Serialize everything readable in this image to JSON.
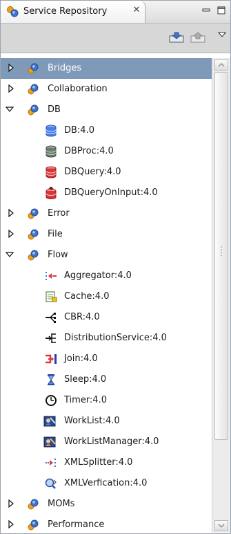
{
  "view": {
    "title": "Service Repository",
    "close_glyph": "✕"
  },
  "icons": {
    "view_icon": "service-repository-icon",
    "close": "close-icon",
    "minimize": "minimize-icon",
    "maximize": "maximize-icon",
    "import": "import-icon",
    "export": "export-icon",
    "view_menu": "view-menu-icon"
  },
  "tree": {
    "items": [
      {
        "label": "Bridges",
        "kind": "folder",
        "expanded": false,
        "selected": true
      },
      {
        "label": "Collaboration",
        "kind": "folder",
        "expanded": false
      },
      {
        "label": "DB",
        "kind": "folder",
        "expanded": true
      },
      {
        "label": "DB:4.0",
        "kind": "db",
        "color": "#4a7ee8"
      },
      {
        "label": "DBProc:4.0",
        "kind": "db",
        "color": "#6c7c6c"
      },
      {
        "label": "DBQuery:4.0",
        "kind": "db",
        "color": "#d9363a"
      },
      {
        "label": "DBQueryOnInput:4.0",
        "kind": "db-arrow",
        "color": "#d9363a"
      },
      {
        "label": "Error",
        "kind": "folder",
        "expanded": false
      },
      {
        "label": "File",
        "kind": "folder",
        "expanded": false
      },
      {
        "label": "Flow",
        "kind": "folder",
        "expanded": true
      },
      {
        "label": "Aggregator:4.0",
        "kind": "aggregator-icon"
      },
      {
        "label": "Cache:4.0",
        "kind": "cache-icon"
      },
      {
        "label": "CBR:4.0",
        "kind": "cbr-icon"
      },
      {
        "label": "DistributionService:4.0",
        "kind": "distribution-icon"
      },
      {
        "label": "Join:4.0",
        "kind": "join-icon"
      },
      {
        "label": "Sleep:4.0",
        "kind": "hourglass-icon"
      },
      {
        "label": "Timer:4.0",
        "kind": "clock-icon"
      },
      {
        "label": "WorkList:4.0",
        "kind": "worklist-icon"
      },
      {
        "label": "WorkListManager:4.0",
        "kind": "worklist-manager-icon"
      },
      {
        "label": "XMLSplitter:4.0",
        "kind": "splitter-icon"
      },
      {
        "label": "XMLVerfication:4.0",
        "kind": "xml-verify-icon"
      },
      {
        "label": "MOMs",
        "kind": "folder",
        "expanded": false
      },
      {
        "label": "Performance",
        "kind": "folder",
        "expanded": false
      }
    ]
  },
  "colors": {
    "selection": "#7f9ab9",
    "folder_icon_blue": "#3f74c9",
    "folder_icon_orange": "#f0a020"
  }
}
